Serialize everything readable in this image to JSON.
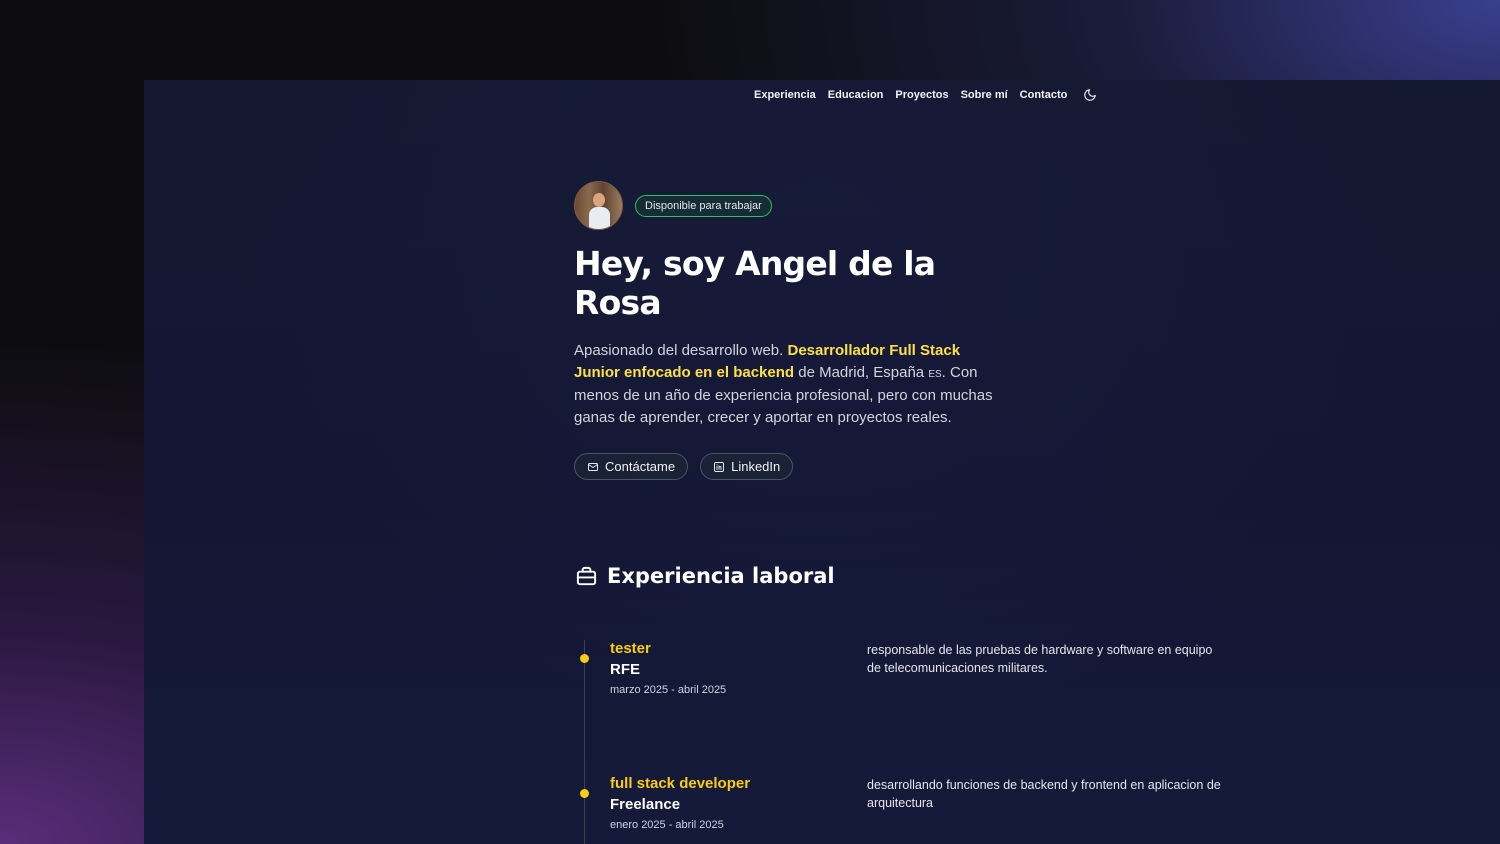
{
  "nav": {
    "items": [
      "Experiencia",
      "Educacion",
      "Proyectos",
      "Sobre mí",
      "Contacto"
    ],
    "theme_toggle_icon": "moon-icon"
  },
  "hero": {
    "badge": "Disponible para trabajar",
    "title": "Hey, soy Angel de la Rosa",
    "intro_1": "Apasionado del desarrollo web. ",
    "intro_highlight": "Desarrollador Full Stack Junior enfocado en el backend",
    "intro_2": " de Madrid, España ",
    "intro_flag": "ES",
    "intro_3": ". Con menos de un año de experiencia profesional, pero con muchas ganas de aprender, crecer y aportar en proyectos reales.",
    "buttons": {
      "contact": "Contáctame",
      "linkedin": "LinkedIn"
    }
  },
  "experience": {
    "title": "Experiencia laboral",
    "jobs": [
      {
        "role": "tester",
        "company": "RFE",
        "dates": "marzo 2025 - abril 2025",
        "description": "responsable de las pruebas de hardware y software en equipo de telecomunicaciones militares."
      },
      {
        "role": "full stack developer",
        "company": "Freelance",
        "dates": "enero 2025 - abril 2025",
        "description": "desarrollando funciones de backend y frontend en aplicacion de arquitectura"
      }
    ]
  },
  "colors": {
    "accent": "#facc15",
    "badge_border": "#22c55e",
    "background": "#131733"
  }
}
